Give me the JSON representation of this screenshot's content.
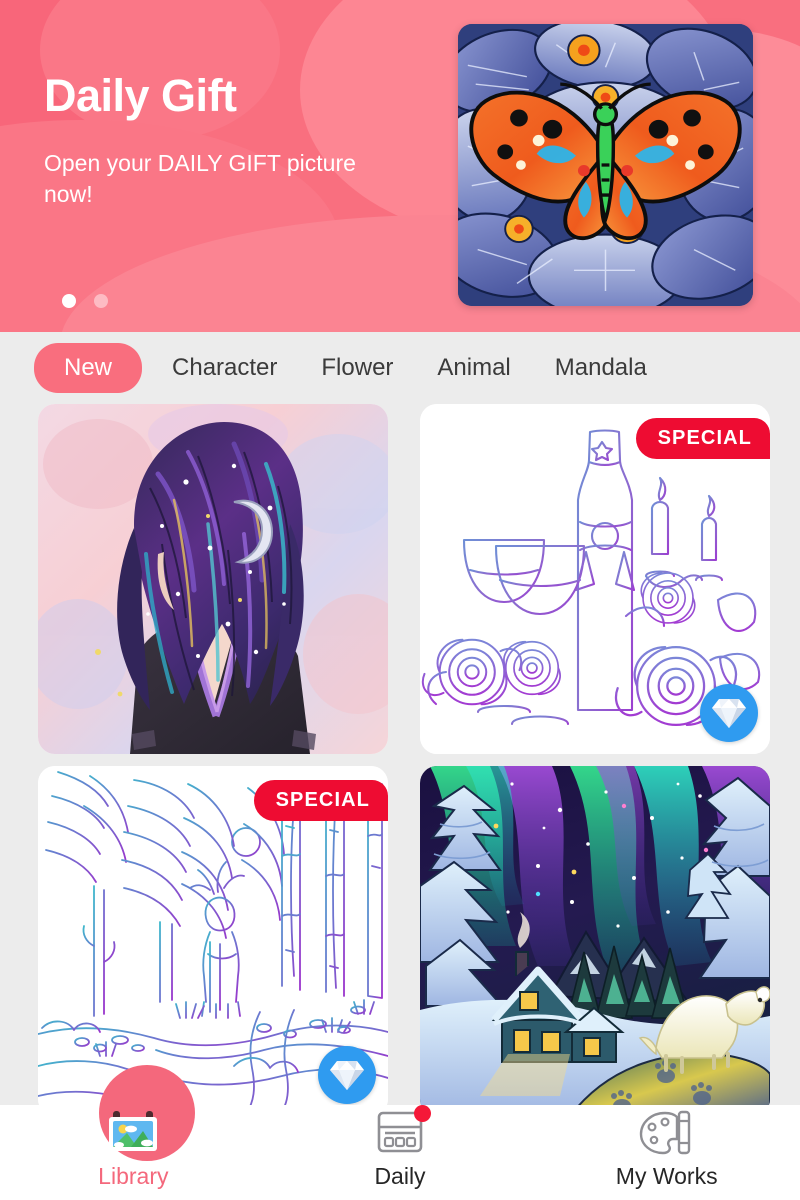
{
  "banner": {
    "title": "Daily Gift",
    "subtitle": "Open your DAILY GIFT picture now!",
    "artwork_name": "butterfly-on-blue-flowers",
    "pagination": {
      "total": 2,
      "active_index": 0
    },
    "background_color": "#f96f7f"
  },
  "tabs": [
    {
      "label": "New",
      "active": true
    },
    {
      "label": "Character",
      "active": false
    },
    {
      "label": "Flower",
      "active": false
    },
    {
      "label": "Animal",
      "active": false
    },
    {
      "label": "Mandala",
      "active": false
    }
  ],
  "tab_active_color": "#f96e7e",
  "cards": [
    {
      "artwork_name": "galaxy-hair-girl",
      "type": "colored",
      "special": false,
      "gem": false,
      "special_label": "",
      "gem_icon": "diamond-icon"
    },
    {
      "artwork_name": "champagne-bottle-roses-lineart",
      "type": "lineart",
      "special": true,
      "gem": true,
      "special_label": "SPECIAL",
      "gem_icon": "diamond-icon"
    },
    {
      "artwork_name": "winter-forest-deer-lineart",
      "type": "lineart",
      "special": true,
      "gem": true,
      "special_label": "SPECIAL",
      "gem_icon": "diamond-icon"
    },
    {
      "artwork_name": "aurora-polar-bear-cabin",
      "type": "colored",
      "special": false,
      "gem": false,
      "special_label": "",
      "gem_icon": "diamond-icon"
    }
  ],
  "badge_special_color": "#ee0c32",
  "badge_gem_color": "#2f9bf0",
  "bottom_nav": [
    {
      "label": "Library",
      "icon": "photo-gallery-icon",
      "active": true,
      "badge": false
    },
    {
      "label": "Daily",
      "icon": "calendar-icon",
      "active": false,
      "badge": true
    },
    {
      "label": "My Works",
      "icon": "palette-brush-icon",
      "active": false,
      "badge": false
    }
  ],
  "nav_active_color": "#f4687c",
  "nav_badge_color": "#f51838"
}
